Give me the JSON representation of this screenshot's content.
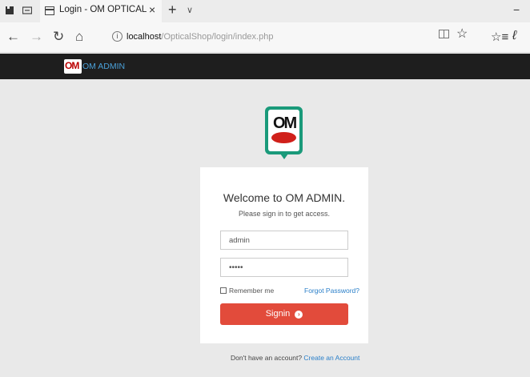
{
  "browser": {
    "tab_title": "Login - OM OPTICAL",
    "tab_close": "×",
    "new_tab": "+",
    "tab_list": "∨",
    "minimize": "−",
    "url_host": "localhost",
    "url_path": "/OpticalShop/login/index.php"
  },
  "icons": {
    "back": "←",
    "forward": "→",
    "refresh": "↻",
    "home": "⌂",
    "star": "☆",
    "hub": "☆≡",
    "pen": "ℓ"
  },
  "header": {
    "logo_text": "OM",
    "title": "OM ADMIN"
  },
  "logo": {
    "text": "OM",
    "accent": "#1a9a7a",
    "brand_red": "#d0201a"
  },
  "login": {
    "welcome": "Welcome to OM ADMIN.",
    "subtitle": "Please sign in to get access.",
    "username_value": "admin",
    "password_value": "•••••",
    "remember_label": "Remember me",
    "forgot_label": "Forgot Password?",
    "signin_label": "Signin",
    "signin_color": "#e24b3b"
  },
  "footer": {
    "no_account": "Don't have an account?",
    "create_link": "Create an Account"
  }
}
